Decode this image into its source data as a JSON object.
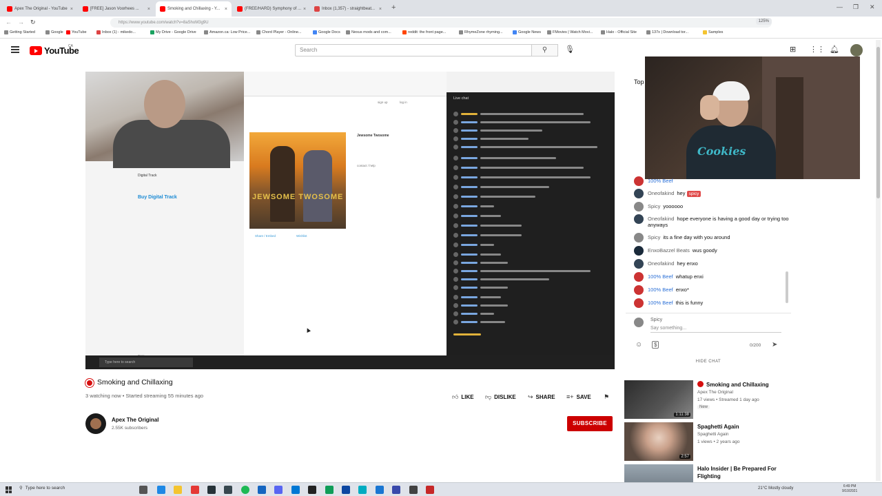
{
  "browser": {
    "tabs": [
      {
        "label": "Apex The Original - YouTube",
        "active": false
      },
      {
        "label": "[FREE] Jason Voorhees ...",
        "active": false
      },
      {
        "label": "Smoking and Chillaxing - Y...",
        "active": true
      },
      {
        "label": "(FREE/HARD) Symphony of ...",
        "active": false
      },
      {
        "label": "Inbox (1,357) - straightbeat...",
        "active": false
      }
    ],
    "url": "https://www.youtube.com/watch?v=8aShoM3g9U",
    "zoom": "125%",
    "bookmarks": [
      "Getting Started",
      "Google",
      "YouTube",
      "Inbox (1) - mikedo...",
      "My Drive - Google Drive",
      "Amazon.ca: Low Price...",
      "Chord Player - Online...",
      "Google Docs",
      "Nexus mods and com...",
      "reddit: the front page...",
      "RhymeZone rhyming...",
      "Google News",
      "FMovies | Watch Movi...",
      "Halo - Official Site",
      "137x | Download tor...",
      "Samples"
    ]
  },
  "youtube": {
    "logo_text": "YouTube",
    "country": "CA",
    "search_placeholder": "Search"
  },
  "video": {
    "title": "Smoking and Chillaxing",
    "meta": "3 watching now • Started streaming 55 minutes ago",
    "like_label": "LIKE",
    "dislike_label": "DISLIKE",
    "share_label": "SHARE",
    "save_label": "SAVE",
    "channel_name": "Apex The Original",
    "channel_subs": "2.55K subscribers",
    "subscribe_label": "SUBSCRIBE",
    "embedded": {
      "digital_track": "Digital Track",
      "buy_label": "Buy Digital Track",
      "artist_title": "Jewsome Twosome",
      "album_text": "JEWSOME TWOSOME",
      "share_label": "Share / Embed",
      "wishlist_label": "Wishlist",
      "sign_up": "sign up",
      "log_in": "log in",
      "contact_help": "contact / help",
      "tags_label": "Tags",
      "inner_chat_title": "Live chat",
      "inner_taskbar_search": "Type here to search"
    }
  },
  "chat": {
    "top_label": "Top",
    "messages": [
      {
        "author": "100% Beef",
        "member": true,
        "text": ""
      },
      {
        "author": "Oneofakind",
        "member": false,
        "text": "hey",
        "badge": "spicy"
      },
      {
        "author": "Spicy",
        "member": false,
        "text": "yoooooo"
      },
      {
        "author": "Oneofakind",
        "member": false,
        "text": "hope everyone is having a good day or trying too anyways"
      },
      {
        "author": "Spicy",
        "member": false,
        "text": "its a fine day with you around"
      },
      {
        "author": "EnxoBazzel Beats",
        "member": false,
        "text": "wus goody"
      },
      {
        "author": "Oneofakind",
        "member": false,
        "text": "hey enxo"
      },
      {
        "author": "100% Beef",
        "member": true,
        "text": "whatup enxi"
      },
      {
        "author": "100% Beef",
        "member": true,
        "text": "enxo*"
      },
      {
        "author": "100% Beef",
        "member": true,
        "text": "this is funny"
      }
    ],
    "self_name": "Spicy",
    "input_placeholder": "Say something...",
    "char_count": "0/200",
    "hide_label": "HIDE CHAT"
  },
  "recommendations": [
    {
      "title": "Smoking and Chillaxing",
      "channel": "Apex The Original",
      "stats": "17 views • Streamed 1 day ago",
      "badge": "New",
      "duration": "1:11:38",
      "live_dot": true
    },
    {
      "title": "Spaghetti Again",
      "channel": "Spaghetti Again",
      "stats": "1 views • 2 years ago",
      "duration": "2:57",
      "live_dot": false
    },
    {
      "title": "Halo Insider | Be Prepared For Flighting",
      "channel": "",
      "stats": "",
      "duration": "",
      "live_dot": false
    }
  ],
  "taskbar": {
    "search_label": "Type here to search",
    "weather": "21°C Mostly cloudy",
    "time": "6:49 PM",
    "date": "9/10/2021"
  },
  "icons": {
    "menu": "menu-icon",
    "search": "search-icon",
    "mic": "mic-icon",
    "create": "create-icon",
    "apps": "apps-icon",
    "bell": "bell-icon"
  },
  "colors": {
    "youtube_red": "#ff0000",
    "subscribe": "#cc0000",
    "member_blue": "#2a6fd6"
  }
}
